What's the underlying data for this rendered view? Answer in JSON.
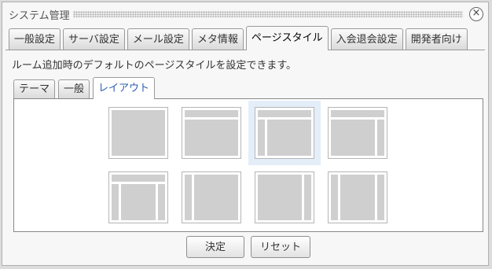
{
  "dialog": {
    "title": "システム管理"
  },
  "icons": {
    "close": "close-circle-icon"
  },
  "main_tabs": [
    {
      "label": "一般設定"
    },
    {
      "label": "サーバ設定"
    },
    {
      "label": "メール設定"
    },
    {
      "label": "メタ情報"
    },
    {
      "label": "ページスタイル",
      "active": true
    },
    {
      "label": "入会退会設定"
    },
    {
      "label": "開発者向け"
    }
  ],
  "description": "ルーム追加時のデフォルトのページスタイルを設定できます。",
  "sub_tabs": [
    {
      "label": "テーマ"
    },
    {
      "label": "一般"
    },
    {
      "label": "レイアウト",
      "active": true
    }
  ],
  "layouts": [
    {
      "name": "layout-main-only"
    },
    {
      "name": "layout-header-main"
    },
    {
      "name": "layout-header-left-main",
      "selected": true
    },
    {
      "name": "layout-header-main-right"
    },
    {
      "name": "layout-header-left-main-right"
    },
    {
      "name": "layout-left-main"
    },
    {
      "name": "layout-main-right"
    },
    {
      "name": "layout-left-main-right"
    }
  ],
  "buttons": {
    "ok": "決定",
    "reset": "リセット"
  }
}
